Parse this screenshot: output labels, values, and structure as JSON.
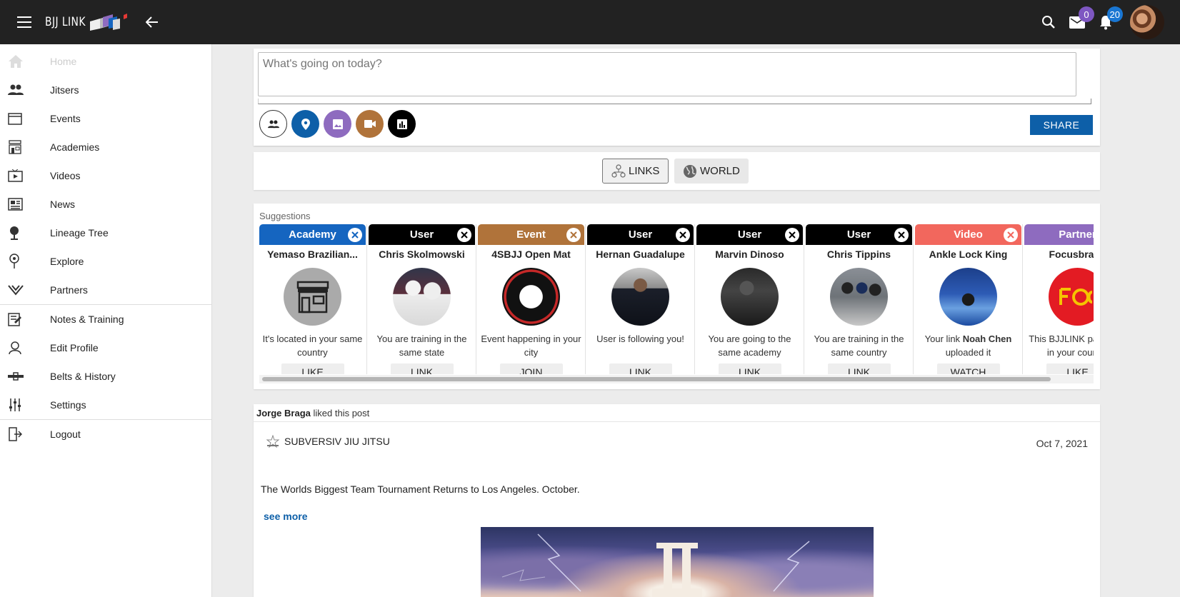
{
  "topbar": {
    "logo_text": "BJJ LINK",
    "messages_count": "0",
    "notifications_count": "20",
    "messages_badge_color": "#7e57c2",
    "notifications_badge_color": "#1976d2"
  },
  "sidebar": {
    "items": [
      {
        "label": "Home",
        "icon": "home-icon"
      },
      {
        "label": "Jitsers",
        "icon": "people-icon"
      },
      {
        "label": "Events",
        "icon": "calendar-icon"
      },
      {
        "label": "Academies",
        "icon": "academy-icon"
      },
      {
        "label": "Videos",
        "icon": "video-icon"
      },
      {
        "label": "News",
        "icon": "news-icon"
      },
      {
        "label": "Lineage Tree",
        "icon": "tree-icon"
      },
      {
        "label": "Explore",
        "icon": "explore-icon"
      },
      {
        "label": "Partners",
        "icon": "partners-icon"
      },
      {
        "label": "Notes & Training",
        "icon": "notes-icon"
      },
      {
        "label": "Edit Profile",
        "icon": "edit-profile-icon"
      },
      {
        "label": "Belts & History",
        "icon": "belt-icon"
      },
      {
        "label": "Settings",
        "icon": "settings-icon"
      },
      {
        "label": "Logout",
        "icon": "logout-icon"
      }
    ]
  },
  "composer": {
    "placeholder": "What's going on today?",
    "share_label": "SHARE",
    "buttons": [
      "tag-people",
      "location",
      "photo",
      "video",
      "poll"
    ]
  },
  "feed_toggle": {
    "links_label": "LINKS",
    "world_label": "WORLD"
  },
  "suggestions": {
    "title": "Suggestions",
    "cards": [
      {
        "type": "Academy",
        "color": "#1565c0",
        "name": "Yemaso Brazilian...",
        "reason": "It's located in your same country",
        "action": "LIKE"
      },
      {
        "type": "User",
        "color": "#000000",
        "name": "Chris Skolmowski",
        "reason": "You are training in the same state",
        "action": "LINK"
      },
      {
        "type": "Event",
        "color": "#b0733a",
        "name": "4SBJJ Open Mat",
        "reason": "Event happening in your city",
        "action": "JOIN"
      },
      {
        "type": "User",
        "color": "#000000",
        "name": "Hernan Guadalupe",
        "reason": "User is following you!",
        "action": "LINK"
      },
      {
        "type": "User",
        "color": "#000000",
        "name": "Marvin Dinoso",
        "reason": "You are going to the same academy",
        "action": "LINK"
      },
      {
        "type": "User",
        "color": "#000000",
        "name": "Chris Tippins",
        "reason": "You are training in the same country",
        "action": "LINK"
      },
      {
        "type": "Video",
        "color": "#f2675d",
        "name": "Ankle Lock King",
        "reason_prefix": "Your link",
        "reason_bold": "Noah Chen",
        "reason_suffix": "uploaded it",
        "action": "WATCH"
      },
      {
        "type": "Partner",
        "color": "#8e6bbf",
        "name": "Focusbrand",
        "reason": "This BJJLINK partner is in your country",
        "action": "LIKE"
      }
    ]
  },
  "post": {
    "liker": "Jorge Braga",
    "activity_text": "liked this post",
    "author": "SUBVERSIV JIU JITSU",
    "date": "Oct 7, 2021",
    "text": "The Worlds Biggest Team Tournament Returns to Los Angeles. October.",
    "see_more": "see more"
  }
}
